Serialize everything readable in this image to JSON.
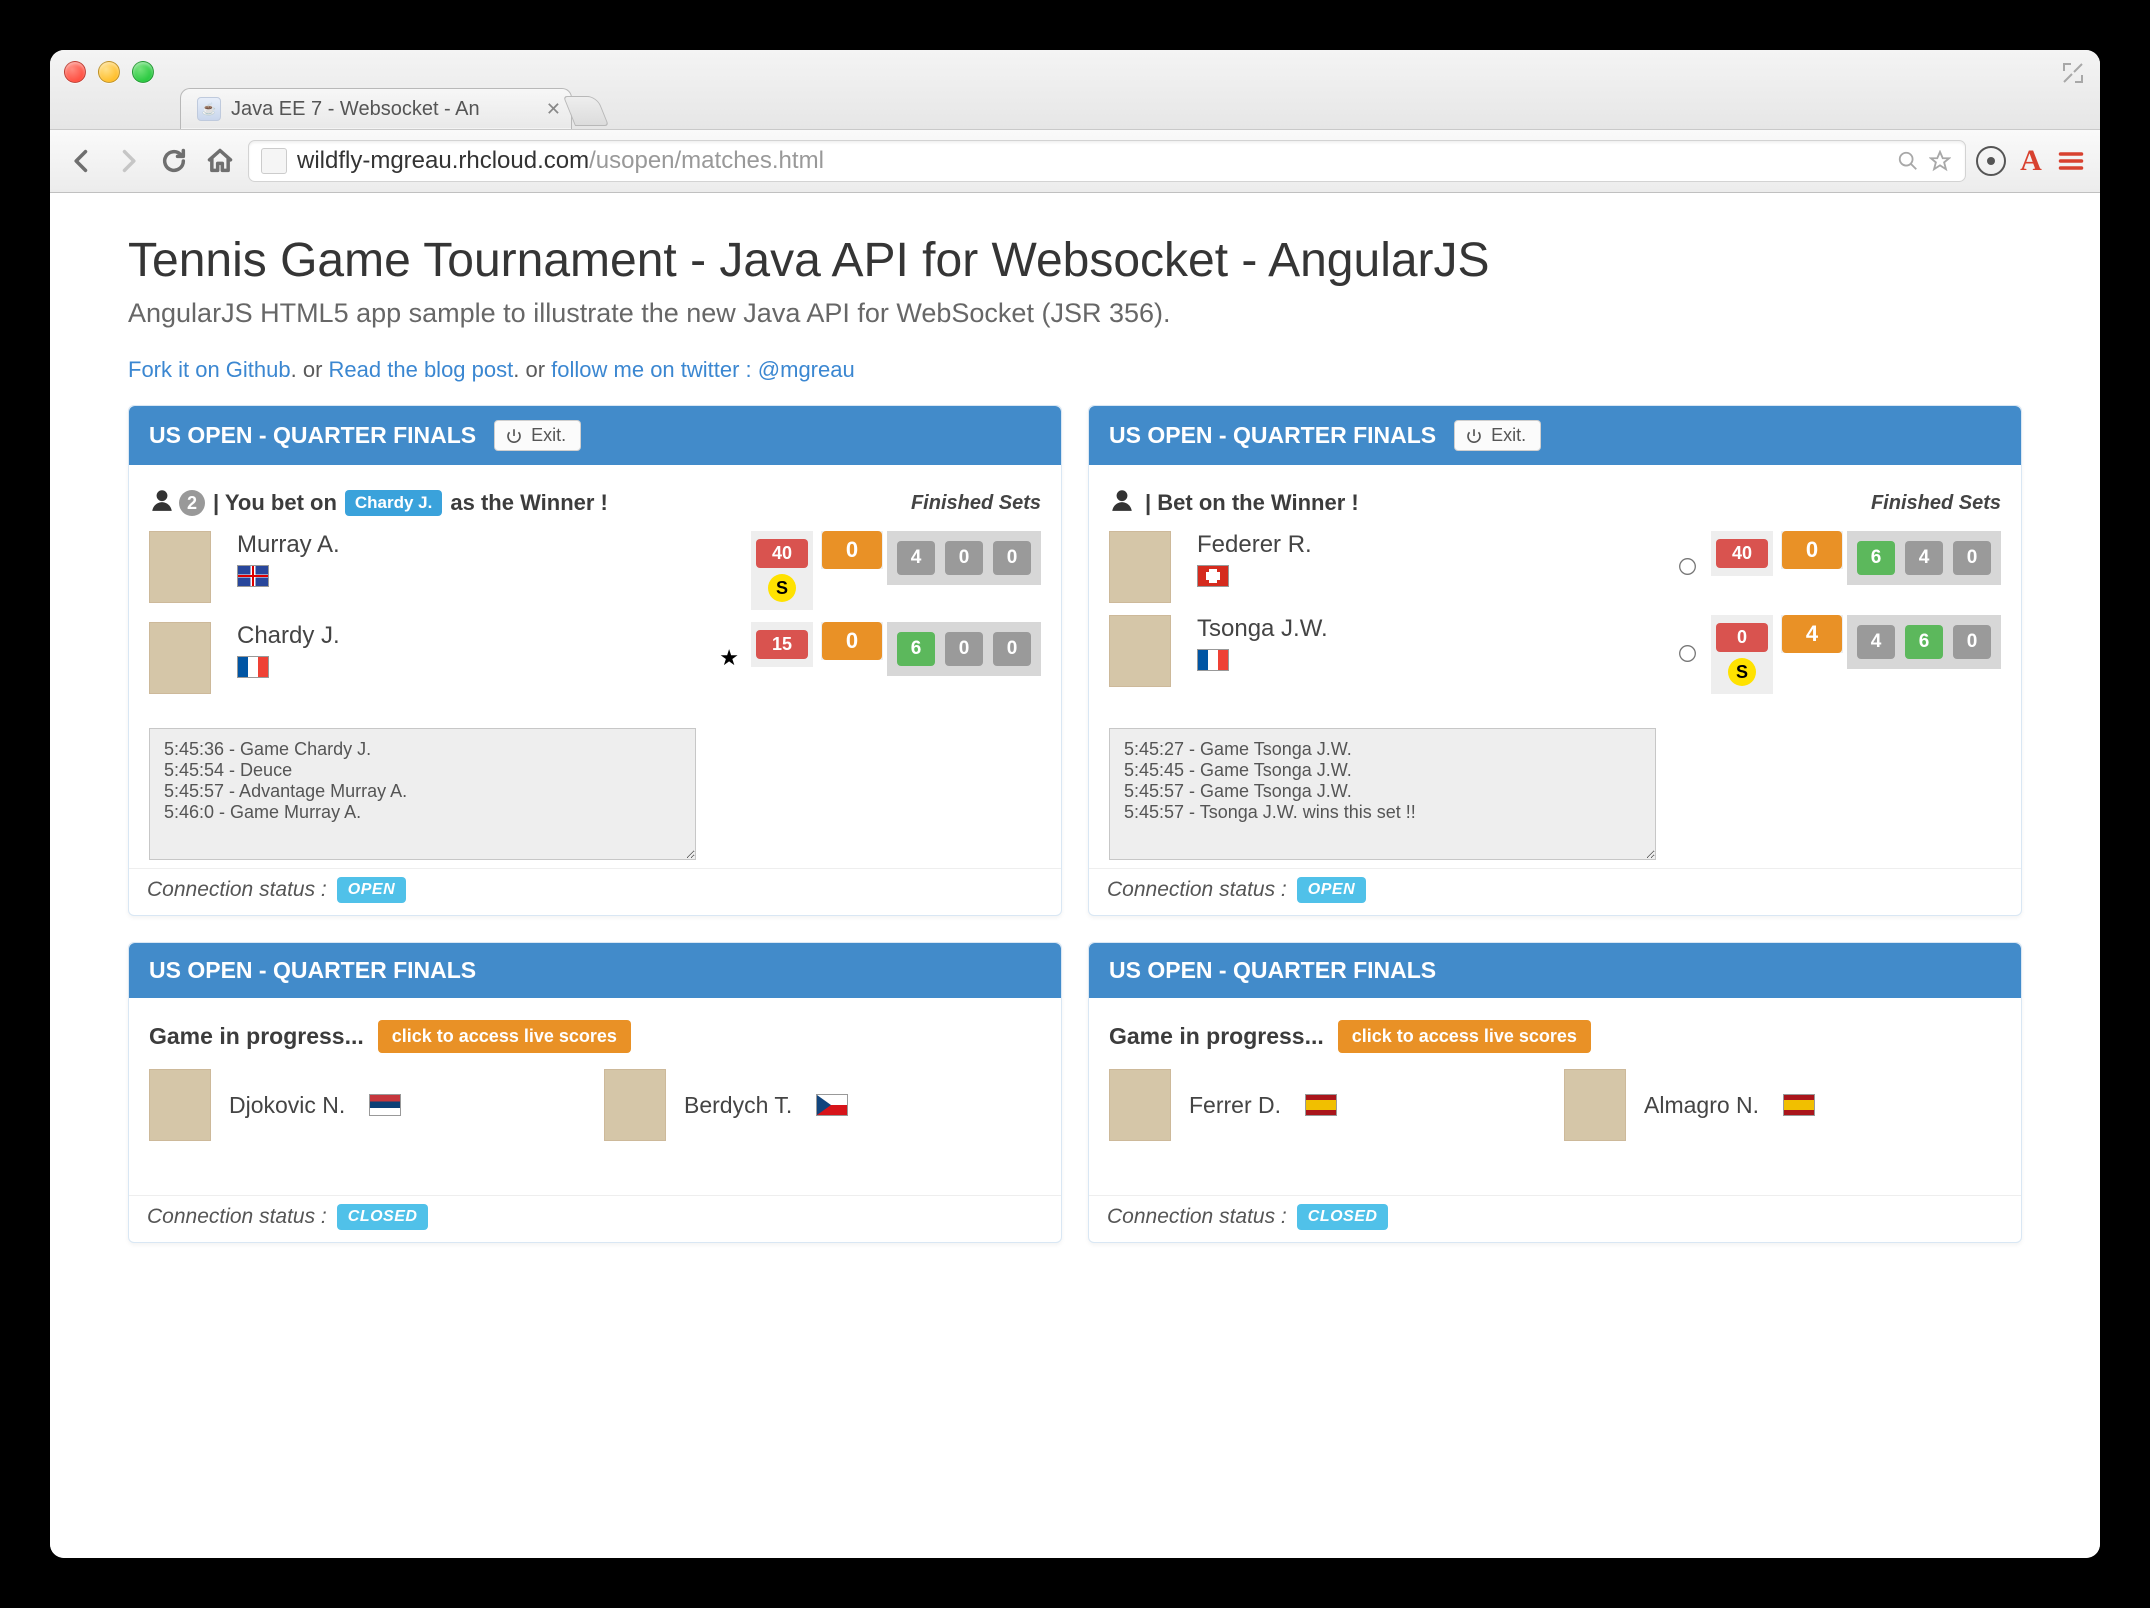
{
  "browser": {
    "tab_title": "Java EE 7 - Websocket - An",
    "url_origin": "wildfly-mgreau.rhcloud.com",
    "url_path": "/usopen/matches.html"
  },
  "page": {
    "title": "Tennis Game Tournament - Java API for Websocket - AngularJS",
    "subtitle": "AngularJS HTML5 app sample to illustrate the new Java API for WebSocket (JSR 356).",
    "link_fork": "Fork it on Github",
    "link_sep": ". or ",
    "link_blog": "Read the blog post",
    "link_twitter": "follow me on twitter : @mgreau",
    "conn_label": "Connection status :",
    "conn_open": "OPEN",
    "conn_closed": "CLOSED",
    "exit_label": "Exit.",
    "finished_sets": "Finished Sets",
    "live_label": "click to access live scores",
    "gip_label": "Game in progress..."
  },
  "match1": {
    "header": "US OPEN - QUARTER FINALS",
    "bet_pre": "| You bet on",
    "bet_chip": "Chardy J.",
    "bet_post": "as the Winner !",
    "bet_count": "2",
    "p1": {
      "name": "Murray A.",
      "flag": "gb",
      "pt": "40",
      "games": "0",
      "serving": true,
      "starred": false,
      "sets": [
        "4",
        "0",
        "0"
      ],
      "sets_win": [
        false,
        false,
        false
      ]
    },
    "p2": {
      "name": "Chardy J.",
      "flag": "fr",
      "pt": "15",
      "games": "0",
      "serving": false,
      "starred": true,
      "sets": [
        "6",
        "0",
        "0"
      ],
      "sets_win": [
        true,
        false,
        false
      ]
    },
    "log": [
      "5:45:36 - Game Chardy J.",
      "5:45:54 - Deuce",
      "5:45:57 - Advantage Murray A.",
      "5:46:0 - Game Murray A."
    ]
  },
  "match2": {
    "header": "US OPEN - QUARTER FINALS",
    "bet_text": "| Bet on the Winner !",
    "p1": {
      "name": "Federer R.",
      "flag": "ch",
      "pt": "40",
      "games": "0",
      "serving": false,
      "sets": [
        "6",
        "4",
        "0"
      ],
      "sets_win": [
        true,
        false,
        false
      ]
    },
    "p2": {
      "name": "Tsonga J.W.",
      "flag": "fr",
      "pt": "0",
      "games": "4",
      "serving": true,
      "sets": [
        "4",
        "6",
        "0"
      ],
      "sets_win": [
        false,
        true,
        false
      ]
    },
    "log": [
      "5:45:27 - Game Tsonga J.W.",
      "5:45:45 - Game Tsonga J.W.",
      "5:45:57 - Game Tsonga J.W.",
      "5:45:57 - Tsonga J.W. wins this set !!"
    ]
  },
  "match3": {
    "header": "US OPEN - QUARTER FINALS",
    "p1": {
      "name": "Djokovic N.",
      "flag": "rs"
    },
    "p2": {
      "name": "Berdych T.",
      "flag": "cz"
    }
  },
  "match4": {
    "header": "US OPEN - QUARTER FINALS",
    "p1": {
      "name": "Ferrer D.",
      "flag": "es"
    },
    "p2": {
      "name": "Almagro N.",
      "flag": "es"
    }
  }
}
